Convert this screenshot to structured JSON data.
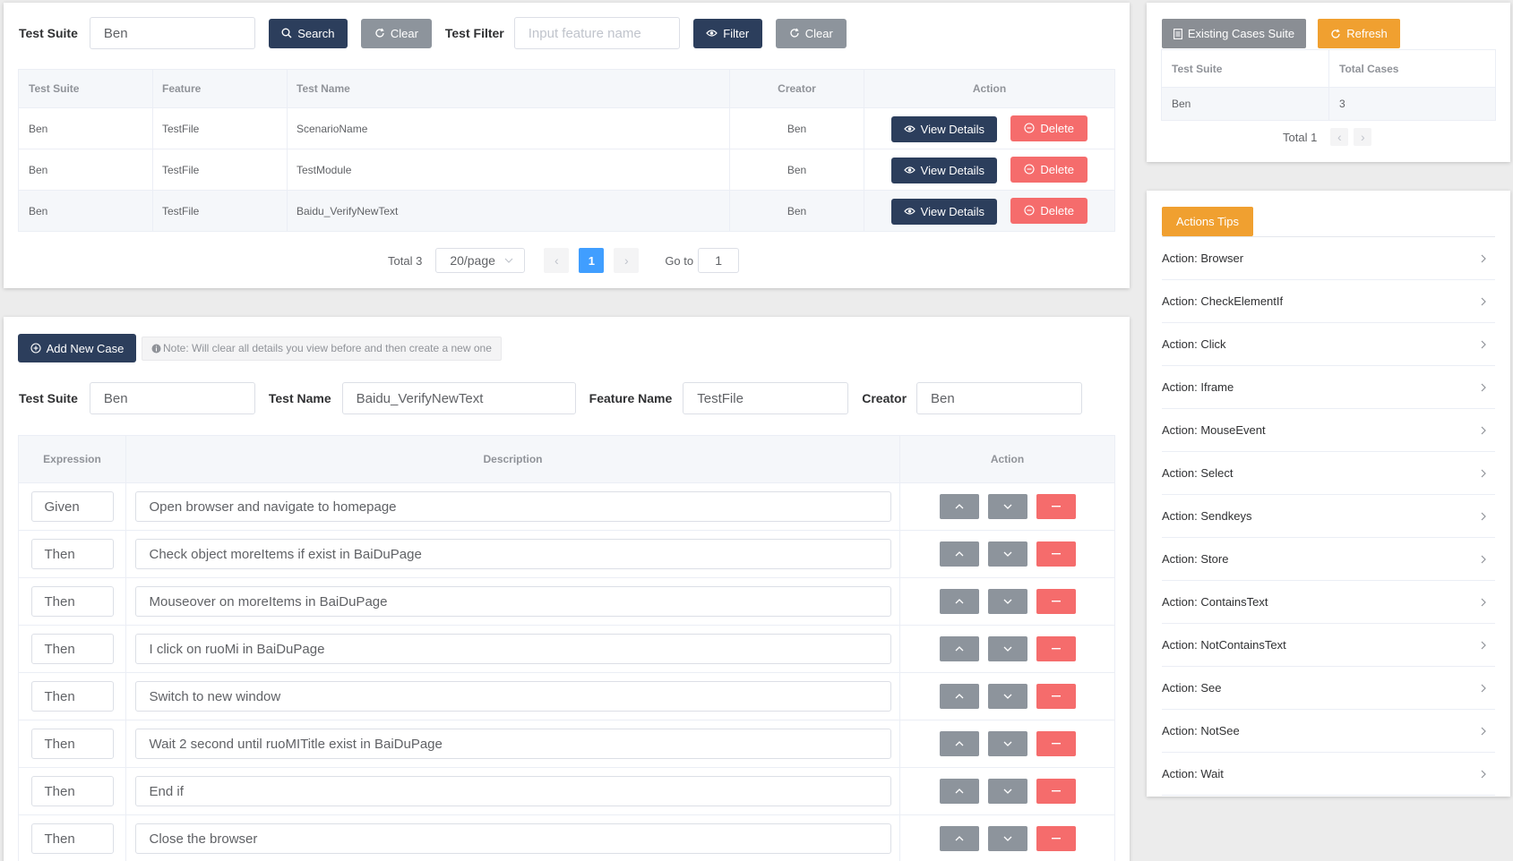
{
  "search_bar": {
    "suite_label": "Test Suite",
    "suite_value": "Ben",
    "search_label": "Search",
    "clear_label": "Clear",
    "filter_label": "Test Filter",
    "filter_placeholder": "Input feature name",
    "filter_button": "Filter",
    "clear2_label": "Clear"
  },
  "cases_table": {
    "headers": [
      "Test Suite",
      "Feature",
      "Test Name",
      "Creator",
      "Action"
    ],
    "rows": [
      {
        "suite": "Ben",
        "feature": "TestFile",
        "name": "ScenarioName",
        "creator": "Ben"
      },
      {
        "suite": "Ben",
        "feature": "TestFile",
        "name": "TestModule",
        "creator": "Ben"
      },
      {
        "suite": "Ben",
        "feature": "TestFile",
        "name": "Baidu_VerifyNewText",
        "creator": "Ben"
      }
    ],
    "view_label": "View Details",
    "delete_label": "Delete"
  },
  "pagination": {
    "total": "Total 3",
    "page_size": "20/page",
    "current_page": "1",
    "goto_label": "Go to",
    "goto_value": "1"
  },
  "editor": {
    "add_button": "Add New Case",
    "note": "Note: Will clear all details you view before and then create a new one",
    "suite_label": "Test Suite",
    "suite_value": "Ben",
    "name_label": "Test Name",
    "name_value": "Baidu_VerifyNewText",
    "feature_label": "Feature Name",
    "feature_value": "TestFile",
    "creator_label": "Creator",
    "creator_value": "Ben",
    "headers": [
      "Expression",
      "Description",
      "Action"
    ],
    "steps": [
      {
        "expr": "Given",
        "desc": "Open browser and navigate to homepage"
      },
      {
        "expr": "Then",
        "desc": "Check object moreItems if exist in BaiDuPage"
      },
      {
        "expr": "Then",
        "desc": "Mouseover on moreItems in BaiDuPage"
      },
      {
        "expr": "Then",
        "desc": "I click on ruoMi in BaiDuPage"
      },
      {
        "expr": "Then",
        "desc": "Switch to new window"
      },
      {
        "expr": "Then",
        "desc": "Wait 2 second until ruoMITitle exist in BaiDuPage"
      },
      {
        "expr": "Then",
        "desc": "End if"
      },
      {
        "expr": "Then",
        "desc": "Close the browser"
      }
    ]
  },
  "suite_summary": {
    "existing_button": "Existing Cases Suite",
    "refresh_button": "Refresh",
    "headers": [
      "Test Suite",
      "Total Cases"
    ],
    "rows": [
      {
        "suite": "Ben",
        "total": "3"
      }
    ],
    "total": "Total 1"
  },
  "tips": {
    "title": "Actions Tips",
    "items": [
      "Action: Browser",
      "Action: CheckElementIf",
      "Action: Click",
      "Action: Iframe",
      "Action: MouseEvent",
      "Action: Select",
      "Action: Sendkeys",
      "Action: Store",
      "Action: ContainsText",
      "Action: NotContainsText",
      "Action: See",
      "Action: NotSee",
      "Action: Wait"
    ]
  },
  "colors": {
    "navy": "#2c3e5c",
    "gray": "#8d949c",
    "danger": "#f56c6c",
    "warning": "#f0a030",
    "primary": "#409eff"
  }
}
